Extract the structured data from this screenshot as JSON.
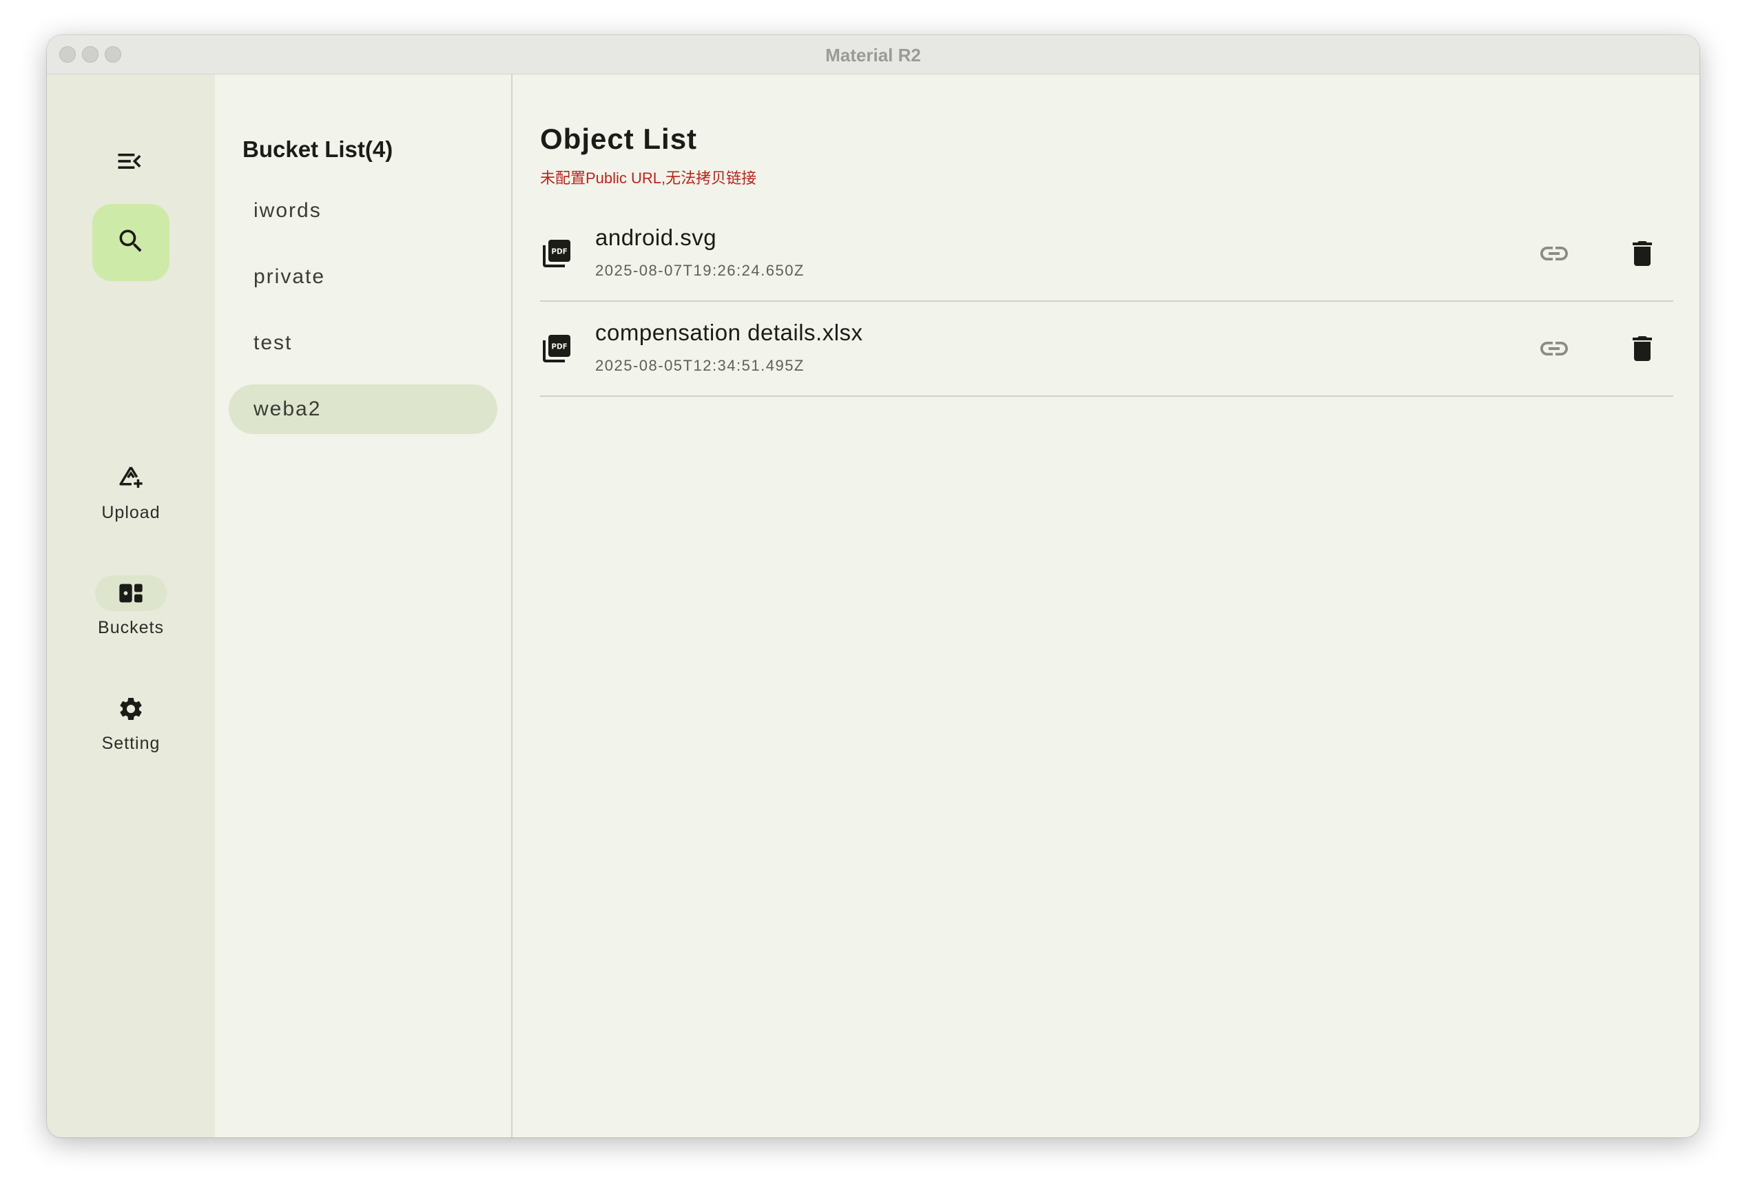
{
  "window": {
    "title": "Material R2"
  },
  "rail": {
    "menu_icon": "menu-open-icon",
    "fab_icon": "search-icon",
    "items": [
      {
        "label": "Upload",
        "icon": "upload-icon",
        "active": false
      },
      {
        "label": "Buckets",
        "icon": "dashboard-icon",
        "active": true
      },
      {
        "label": "Setting",
        "icon": "gear-icon",
        "active": false
      }
    ]
  },
  "buckets": {
    "title": "Bucket List(4)",
    "items": [
      {
        "label": "iwords",
        "active": false
      },
      {
        "label": "private",
        "active": false
      },
      {
        "label": "test",
        "active": false
      },
      {
        "label": "weba2",
        "active": true
      }
    ]
  },
  "objects": {
    "title": "Object List",
    "warning": "未配置Public URL,无法拷贝链接",
    "items": [
      {
        "name": "android.svg",
        "date": "2025-08-07T19:26:24.650Z",
        "icon": "pdf-file-icon"
      },
      {
        "name": "compensation details.xlsx",
        "date": "2025-08-05T12:34:51.495Z",
        "icon": "pdf-file-icon"
      }
    ]
  },
  "colors": {
    "accent_container": "#cdeaa9",
    "selected": "#dde5cc",
    "warning": "#b5261e",
    "surface": "#f2f3ea"
  }
}
